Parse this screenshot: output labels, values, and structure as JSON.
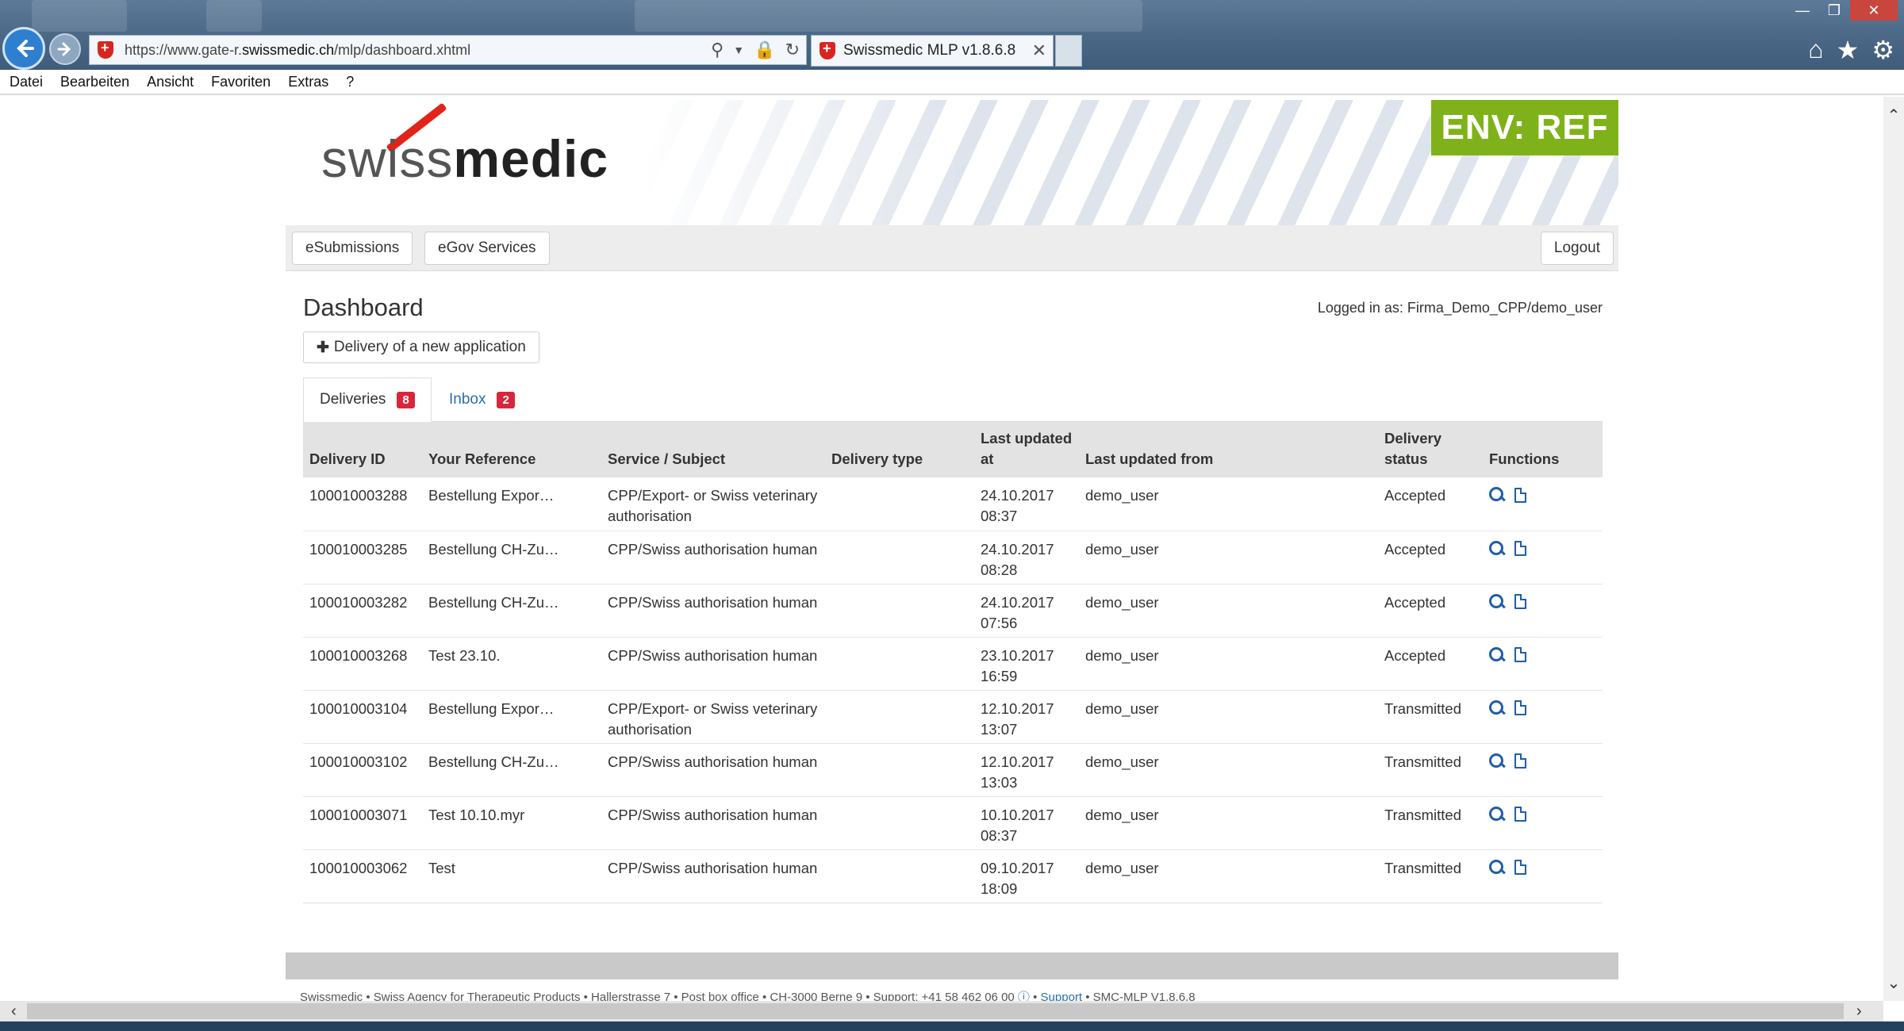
{
  "browser": {
    "url_prefix": "https://www.gate-r.",
    "url_domain": "swissmedic.ch",
    "url_path": "/mlp/dashboard.xhtml",
    "tab_title": "Swissmedic MLP v1.8.6.8",
    "menu": [
      "Datei",
      "Bearbeiten",
      "Ansicht",
      "Favoriten",
      "Extras",
      "?"
    ]
  },
  "header": {
    "logo_part1": "swiss",
    "logo_part2": "medic",
    "env_badge": "ENV: REF"
  },
  "nav": {
    "esubmissions": "eSubmissions",
    "egov": "eGov Services",
    "logout": "Logout"
  },
  "main": {
    "title": "Dashboard",
    "logged_in": "Logged in as: Firma_Demo_CPP/demo_user",
    "new_application": "Delivery of a new application",
    "tabs": [
      {
        "label": "Deliveries",
        "count": "8"
      },
      {
        "label": "Inbox",
        "count": "2"
      }
    ]
  },
  "table": {
    "headers": [
      "Delivery ID",
      "Your Reference",
      "Service / Subject",
      "Delivery type",
      "Last updated at",
      "Last updated from",
      "Delivery status",
      "Functions"
    ],
    "rows": [
      {
        "id": "100010003288",
        "ref": "Bestellung Expor…",
        "service": "CPP/Export- or Swiss veterinary authorisation",
        "type": "",
        "updated": "24.10.2017 08:37",
        "from": "demo_user",
        "status": "Accepted"
      },
      {
        "id": "100010003285",
        "ref": "Bestellung CH-Zu…",
        "service": "CPP/Swiss authorisation human",
        "type": "",
        "updated": "24.10.2017 08:28",
        "from": "demo_user",
        "status": "Accepted"
      },
      {
        "id": "100010003282",
        "ref": "Bestellung CH-Zu…",
        "service": "CPP/Swiss authorisation human",
        "type": "",
        "updated": "24.10.2017 07:56",
        "from": "demo_user",
        "status": "Accepted"
      },
      {
        "id": "100010003268",
        "ref": "Test 23.10.",
        "service": "CPP/Swiss authorisation human",
        "type": "",
        "updated": "23.10.2017 16:59",
        "from": "demo_user",
        "status": "Accepted"
      },
      {
        "id": "100010003104",
        "ref": "Bestellung Expor…",
        "service": "CPP/Export- or Swiss veterinary authorisation",
        "type": "",
        "updated": "12.10.2017 13:07",
        "from": "demo_user",
        "status": "Transmitted"
      },
      {
        "id": "100010003102",
        "ref": "Bestellung CH-Zu…",
        "service": "CPP/Swiss authorisation human",
        "type": "",
        "updated": "12.10.2017 13:03",
        "from": "demo_user",
        "status": "Transmitted"
      },
      {
        "id": "100010003071",
        "ref": "Test 10.10.myr",
        "service": "CPP/Swiss authorisation human",
        "type": "",
        "updated": "10.10.2017 08:37",
        "from": "demo_user",
        "status": "Transmitted"
      },
      {
        "id": "100010003062",
        "ref": "Test",
        "service": "CPP/Swiss authorisation human",
        "type": "",
        "updated": "09.10.2017 18:09",
        "from": "demo_user",
        "status": "Transmitted"
      }
    ]
  },
  "footer": {
    "text": "Swissmedic • Swiss Agency for Therapeutic Products • Hallerstrasse 7 • Post box office • CH-3000 Berne 9 • Support: +41 58 462 06 00",
    "support_link": "Support",
    "version": "SMC-MLP V1.8.6.8"
  },
  "colors": {
    "env_badge": "#7fb21a",
    "badge": "#d9263c",
    "link": "#2a6ead",
    "icon": "#1f5ea8"
  }
}
